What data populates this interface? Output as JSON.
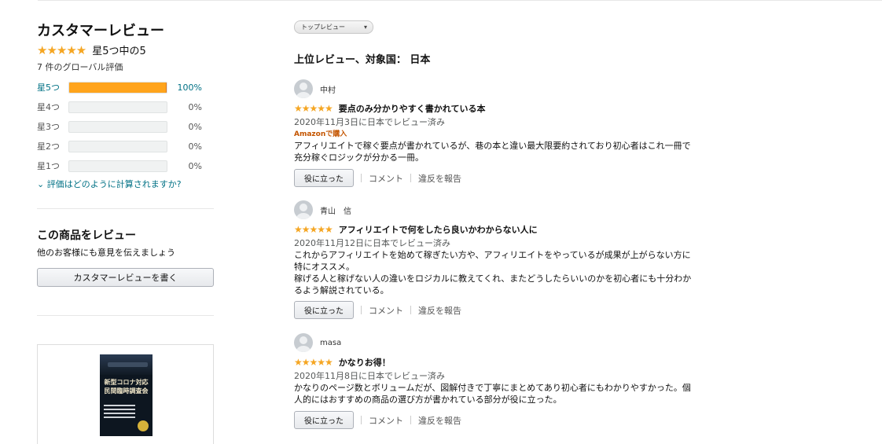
{
  "summary": {
    "title": "カスタマーレビュー",
    "rating_stars": "★★★★★",
    "rating_text": "星5つ中の5",
    "global_count": "7 件のグローバル評価",
    "histogram": [
      {
        "label": "星5つ",
        "percent": "100%",
        "value": 1.0
      },
      {
        "label": "星4つ",
        "percent": "0%",
        "value": 0
      },
      {
        "label": "星3つ",
        "percent": "0%",
        "value": 0
      },
      {
        "label": "星2つ",
        "percent": "0%",
        "value": 0
      },
      {
        "label": "星1つ",
        "percent": "0%",
        "value": 0
      }
    ],
    "how_calculated": "⌄ 評価はどのように計算されますか?"
  },
  "write_review": {
    "title": "この商品をレビュー",
    "subtitle": "他のお客様にも意見を伝えましょう",
    "button": "カスタマーレビューを書く"
  },
  "product": {
    "cover_title": "新型コロナ対応\n民間臨時調査会"
  },
  "sort": {
    "selected": "トップレビュー",
    "arrow": "▾"
  },
  "reviews_heading": "上位レビュー、対象国： 日本",
  "reviews": [
    {
      "name": "中村",
      "stars": "★★★★★",
      "title": "要点のみ分かりやすく書かれている本",
      "date": "2020年11月3日に日本でレビュー済み",
      "verified": "Amazonで購入",
      "body": "アフィリエイトで稼ぐ要点が書かれているが、巷の本と違い最大限要約されており初心者はこれ一冊で充分稼ぐロジックが分かる一冊。",
      "helpful": "役に立った",
      "comment": "コメント",
      "report": "違反を報告"
    },
    {
      "name": "青山　信",
      "stars": "★★★★★",
      "title": "アフィリエイトで何をしたら良いかわからない人に",
      "date": "2020年11月12日に日本でレビュー済み",
      "verified": "",
      "body": "これからアフィリエイトを始めて稼ぎたい方や、アフィリエイトをやっているが成果が上がらない方に特にオススメ。\n稼げる人と稼げない人の違いをロジカルに教えてくれ、またどうしたらいいのかを初心者にも十分わかるよう解説されている。",
      "helpful": "役に立った",
      "comment": "コメント",
      "report": "違反を報告"
    },
    {
      "name": "masa",
      "stars": "★★★★★",
      "title": "かなりお得！",
      "date": "2020年11月8日に日本でレビュー済み",
      "verified": "",
      "body": "かなりのページ数とボリュームだが、図解付きで丁寧にまとめてあり初心者にもわかりやすかった。個人的にはおすすめの商品の選び方が書かれている部分が役に立った。",
      "helpful": "役に立った",
      "comment": "コメント",
      "report": "違反を報告"
    }
  ],
  "colors": {
    "star": "#f5a623",
    "bar_fill": "#ffa41c",
    "link": "#007185",
    "verified": "#c45500"
  }
}
